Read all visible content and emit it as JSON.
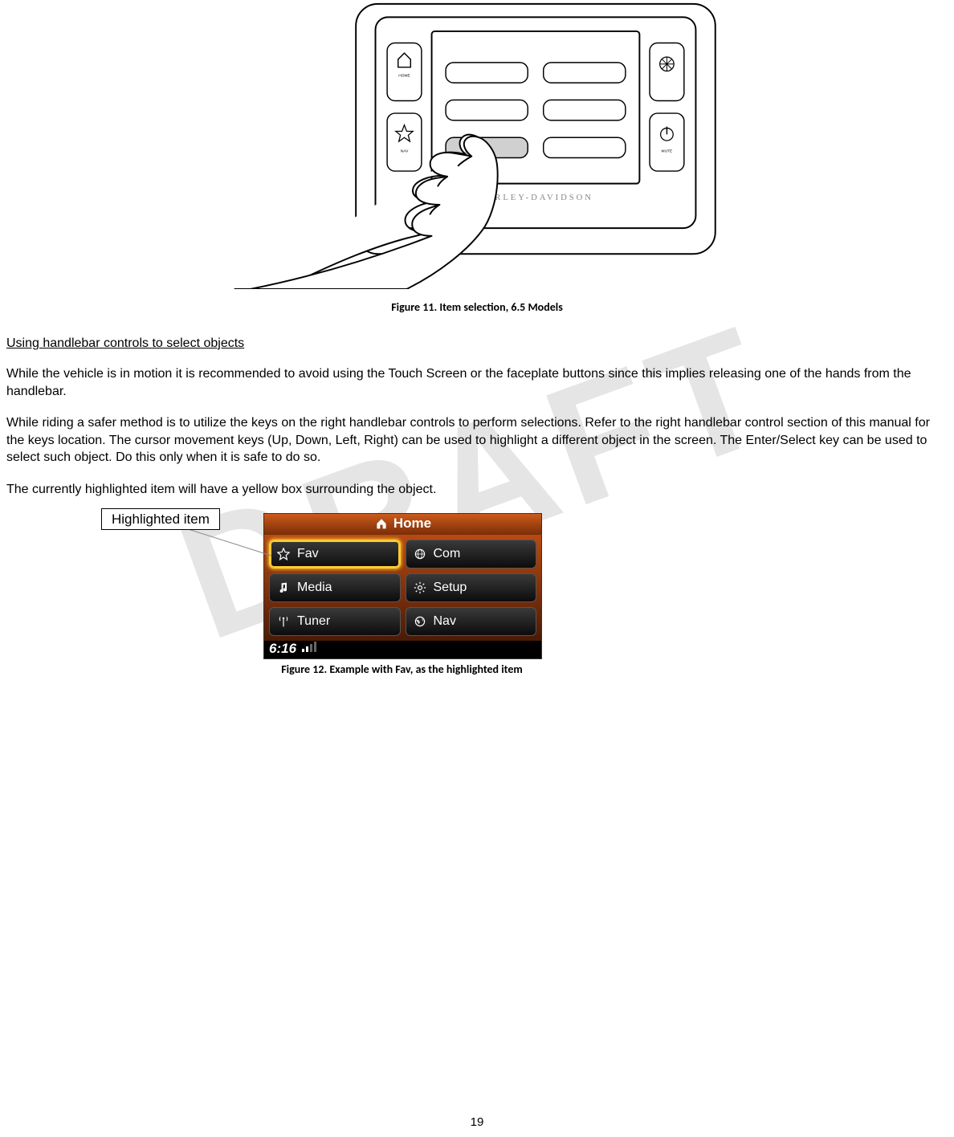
{
  "figure1": {
    "caption": "Figure 11. Item selection, 6.5 Models",
    "brand": "HARLEY-DAVIDSON",
    "side_buttons": {
      "top_left": "HOME",
      "bottom_left": "NAV",
      "top_right_icon": "compass",
      "bottom_right": "MUTE"
    }
  },
  "section": {
    "title": "Using handlebar controls to select objects",
    "para1": "While the vehicle is in motion it is recommended to avoid using the Touch Screen or the faceplate buttons since this implies releasing one of the hands from the handlebar.",
    "para2": "While riding a safer method is to utilize the keys on the right handlebar controls to perform selections. Refer to the right handlebar control section of this manual for the keys location. The cursor movement keys (Up, Down, Left, Right) can be used to highlight a different object in the screen. The Enter/Select key can be used to select such object. Do this only when it is safe to do so.",
    "para3": "The currently highlighted item will have a yellow box surrounding the object."
  },
  "figure2": {
    "callout": "Highlighted item",
    "header": "Home",
    "buttons": [
      {
        "label": "Fav",
        "icon": "star",
        "highlighted": true
      },
      {
        "label": "Com",
        "icon": "globe",
        "highlighted": false
      },
      {
        "label": "Media",
        "icon": "music",
        "highlighted": false
      },
      {
        "label": "Setup",
        "icon": "gear",
        "highlighted": false
      },
      {
        "label": "Tuner",
        "icon": "antenna",
        "highlighted": false
      },
      {
        "label": "Nav",
        "icon": "earth",
        "highlighted": false
      }
    ],
    "time": "6:16",
    "caption": "Figure 12. Example with Fav, as the highlighted item"
  },
  "page_number": "19"
}
